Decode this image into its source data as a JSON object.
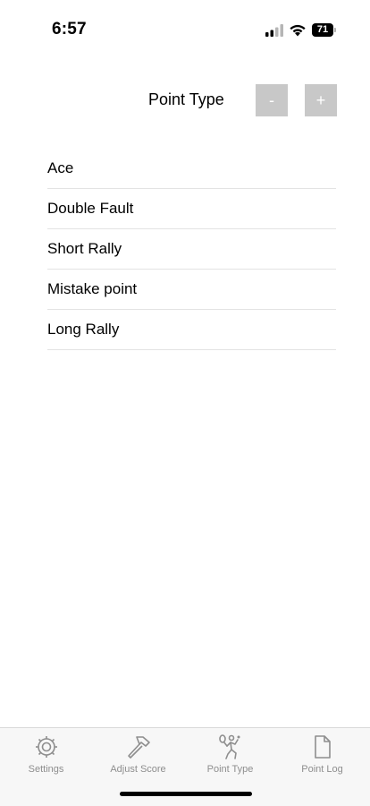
{
  "status_bar": {
    "time": "6:57",
    "battery": "71",
    "signal_icon": "cellular-signal-icon",
    "wifi_icon": "wifi-icon",
    "battery_icon": "battery-icon"
  },
  "header": {
    "title": "Point Type",
    "minus_label": "-",
    "plus_label": "+"
  },
  "point_types": [
    "Ace",
    "Double Fault",
    "Short Rally",
    "Mistake point",
    "Long Rally"
  ],
  "tab_bar": {
    "tabs": [
      {
        "label": "Settings",
        "icon": "gear-icon"
      },
      {
        "label": "Adjust Score",
        "icon": "hammer-icon"
      },
      {
        "label": "Point Type",
        "icon": "tennis-player-icon"
      },
      {
        "label": "Point Log",
        "icon": "document-icon"
      }
    ],
    "inactive_color": "#8e8e8e"
  },
  "colors": {
    "stepper_button": "#c8c8c8",
    "divider": "#e3e3e3",
    "tab_bar_background": "#f7f7f7"
  }
}
